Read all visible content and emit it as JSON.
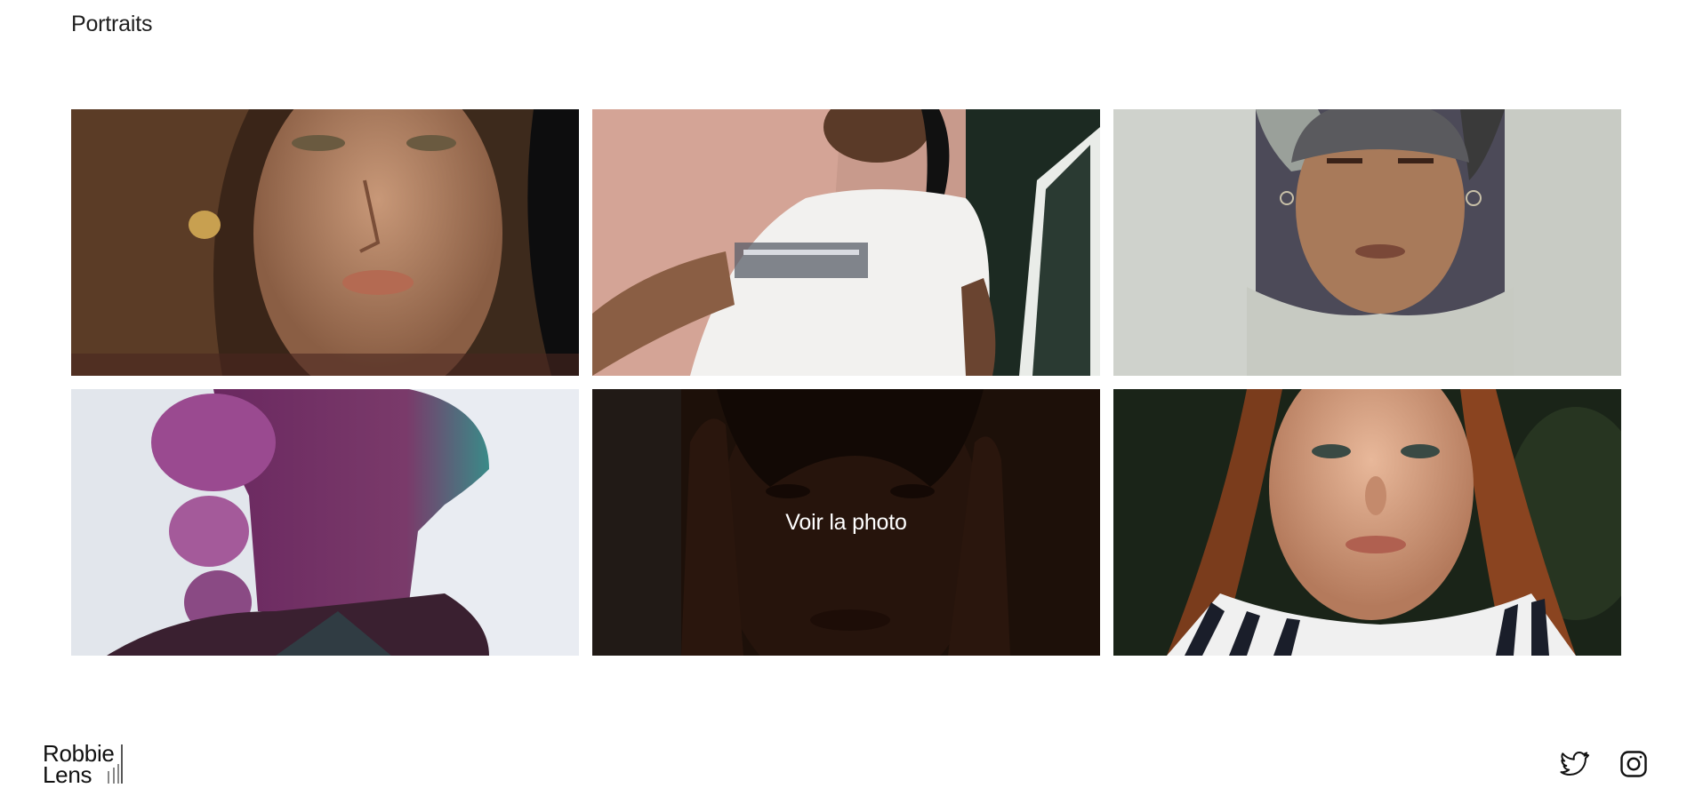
{
  "section": {
    "title": "Portraits"
  },
  "gallery": {
    "hover_label": "Voir la photo",
    "tiles": [
      {
        "subject": "woman-wavy-hair-portrait",
        "hovered": false
      },
      {
        "subject": "person-white-tshirt-portrait",
        "hovered": false
      },
      {
        "subject": "man-bucket-hat-portrait",
        "hovered": false
      },
      {
        "subject": "woman-purple-hair-profile",
        "hovered": false
      },
      {
        "subject": "woman-hands-on-face-portrait",
        "hovered": true
      },
      {
        "subject": "woman-auburn-hair-portrait",
        "hovered": false
      }
    ]
  },
  "footer": {
    "logo_line1": "Robbie",
    "logo_line2": "Lens",
    "social": [
      {
        "icon": "twitter-icon"
      },
      {
        "icon": "instagram-icon"
      }
    ]
  },
  "colors": {
    "background": "#ffffff",
    "text": "#1a1a1a",
    "overlay": "#1a0c06",
    "overlay_text": "#ffffff"
  }
}
